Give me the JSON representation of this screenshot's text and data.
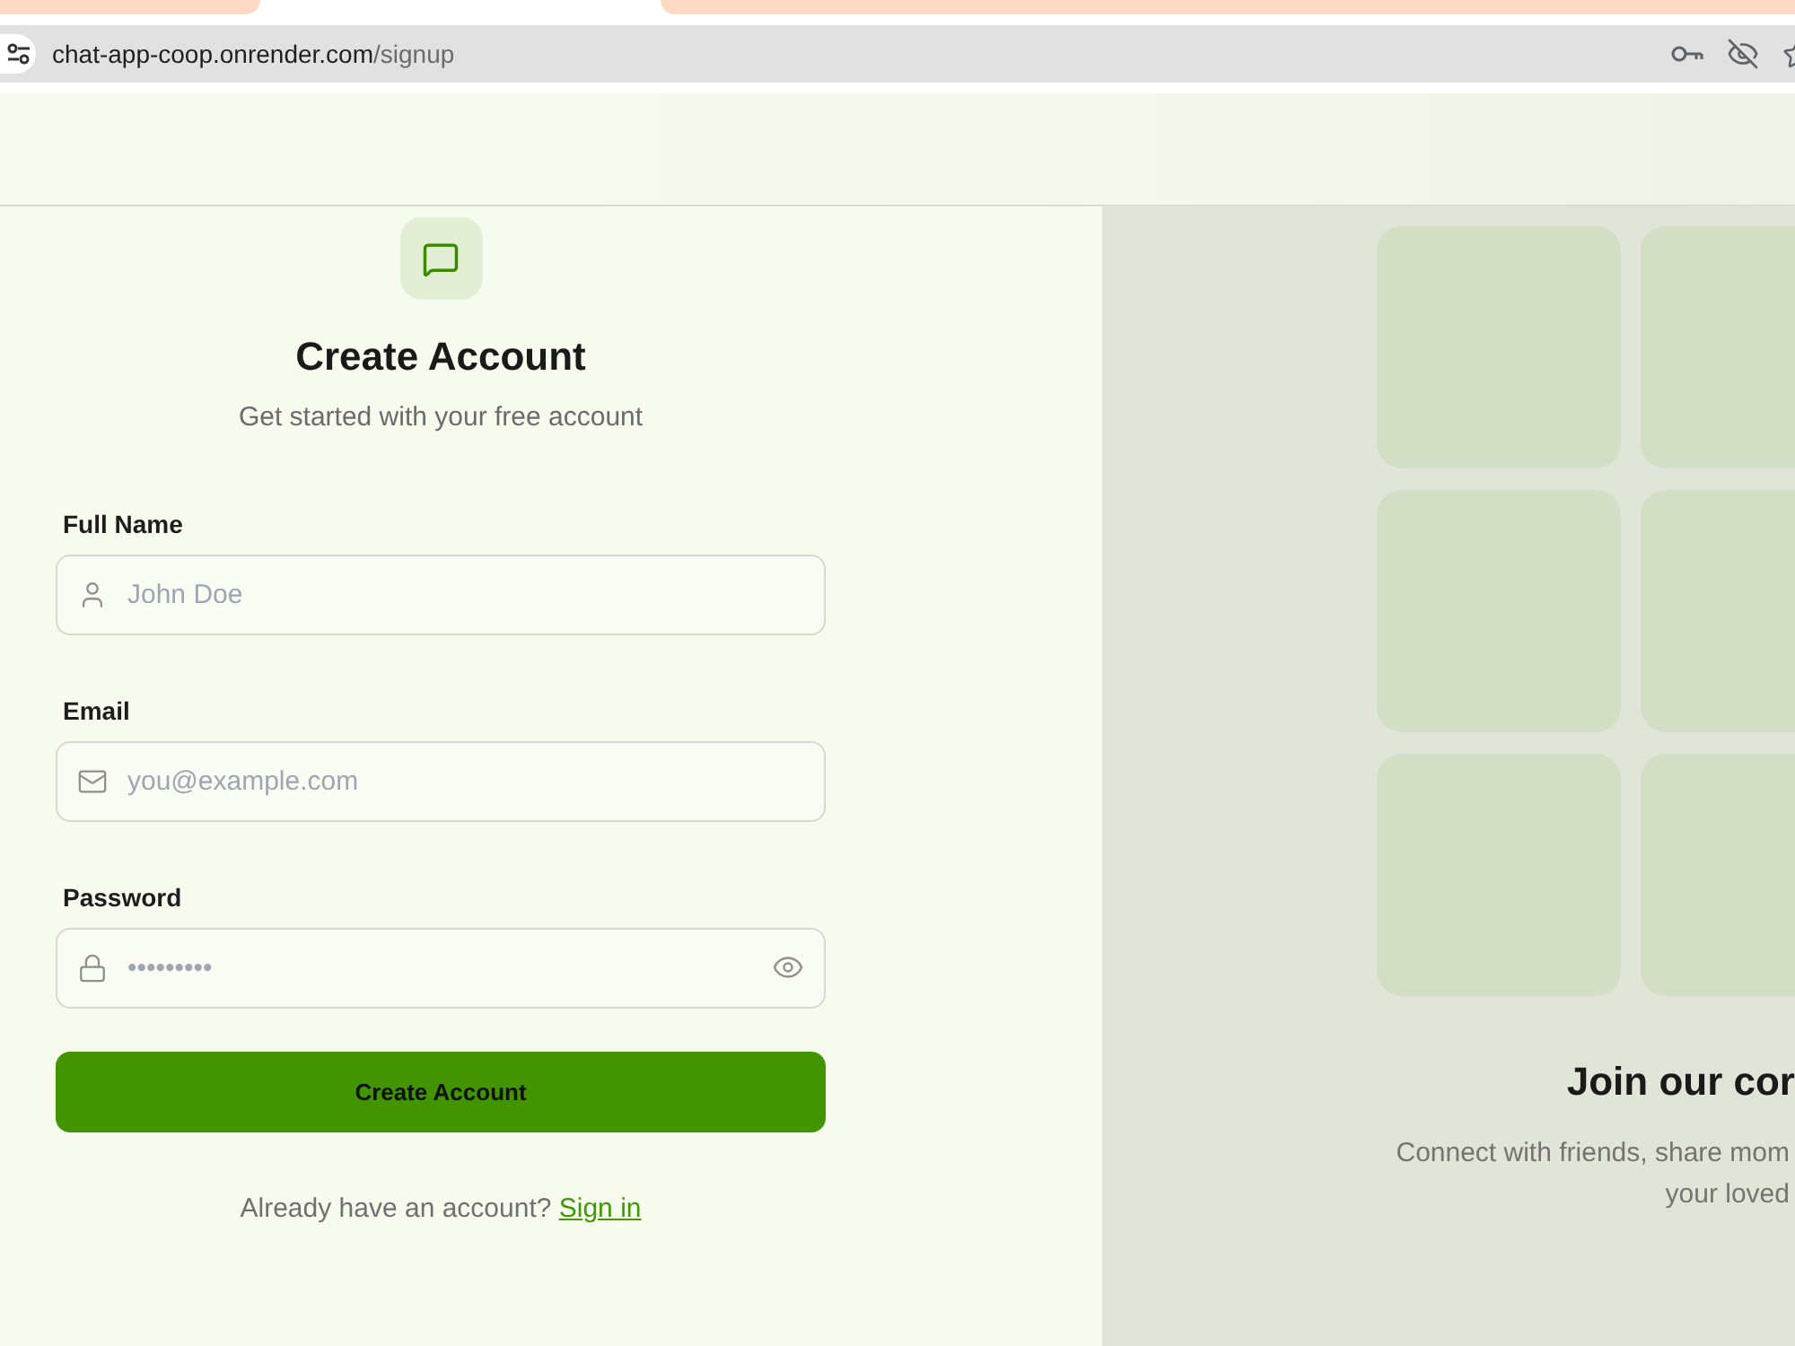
{
  "browser": {
    "url": {
      "host": "chat-app-coop.onrender.com",
      "path": "/signup"
    }
  },
  "form": {
    "title": "Create Account",
    "subtitle": "Get started with your free account",
    "fields": [
      {
        "kind": "name",
        "label": "Full Name",
        "placeholder": "John Doe"
      },
      {
        "kind": "email",
        "label": "Email",
        "placeholder": "you@example.com"
      },
      {
        "kind": "password",
        "label": "Password",
        "placeholder": "•••••••••"
      }
    ],
    "submit_button": "Create Account",
    "signin_prompt": {
      "text": "Already have an account?",
      "link": "Sign in"
    }
  },
  "showcase": {
    "heading": "Join our cor",
    "subtitle_lines": [
      "Connect with friends, share mom",
      "your loved"
    ]
  }
}
